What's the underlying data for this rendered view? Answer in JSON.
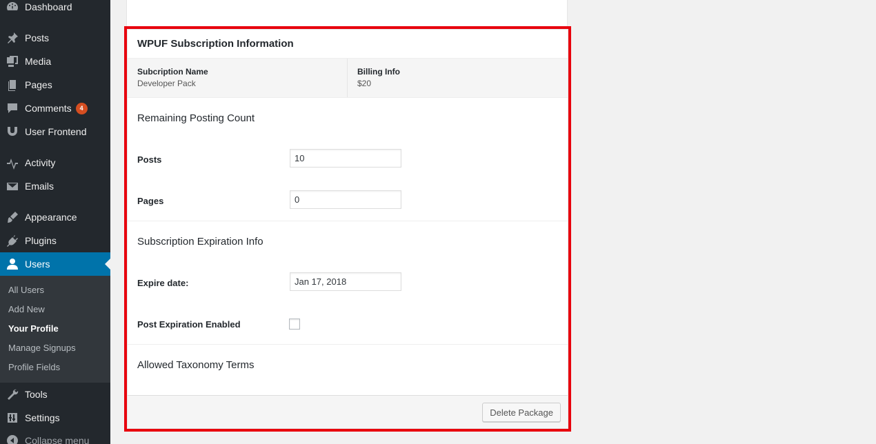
{
  "sidebar": {
    "items": [
      {
        "label": "Dashboard",
        "icon": "dashboard-icon"
      },
      {
        "label": "Posts",
        "icon": "pin-icon"
      },
      {
        "label": "Media",
        "icon": "media-icon"
      },
      {
        "label": "Pages",
        "icon": "pages-icon"
      },
      {
        "label": "Comments",
        "icon": "comment-icon",
        "badge": "4"
      },
      {
        "label": "User Frontend",
        "icon": "user-frontend-icon"
      },
      {
        "label": "Activity",
        "icon": "activity-icon"
      },
      {
        "label": "Emails",
        "icon": "email-icon"
      },
      {
        "label": "Appearance",
        "icon": "brush-icon"
      },
      {
        "label": "Plugins",
        "icon": "plugin-icon"
      },
      {
        "label": "Users",
        "icon": "user-icon",
        "active": true
      },
      {
        "label": "Tools",
        "icon": "wrench-icon"
      },
      {
        "label": "Settings",
        "icon": "settings-icon"
      },
      {
        "label": "Collapse menu",
        "icon": "collapse-icon"
      }
    ],
    "submenu": [
      {
        "label": "All Users"
      },
      {
        "label": "Add New"
      },
      {
        "label": "Your Profile",
        "current": true
      },
      {
        "label": "Manage Signups"
      },
      {
        "label": "Profile Fields"
      }
    ]
  },
  "subscription": {
    "title": "WPUF Subscription Information",
    "subscription_name_label": "Subcription Name",
    "subscription_name_value": "Developer Pack",
    "billing_label": "Billing Info",
    "billing_value": "$20",
    "remaining_title": "Remaining Posting Count",
    "posts_label": "Posts",
    "posts_value": "10",
    "pages_label": "Pages",
    "pages_value": "0",
    "expiration_title": "Subscription Expiration Info",
    "expire_label": "Expire date:",
    "expire_value": "Jan 17, 2018",
    "post_expiration_label": "Post Expiration Enabled",
    "post_expiration_checked": false,
    "taxonomy_title": "Allowed Taxonomy Terms",
    "delete_button": "Delete Package"
  },
  "colors": {
    "sidebar_bg": "#23282d",
    "submenu_bg": "#32373c",
    "active_bg": "#0073aa",
    "highlight": "#e8000d",
    "badge": "#d54e21"
  }
}
